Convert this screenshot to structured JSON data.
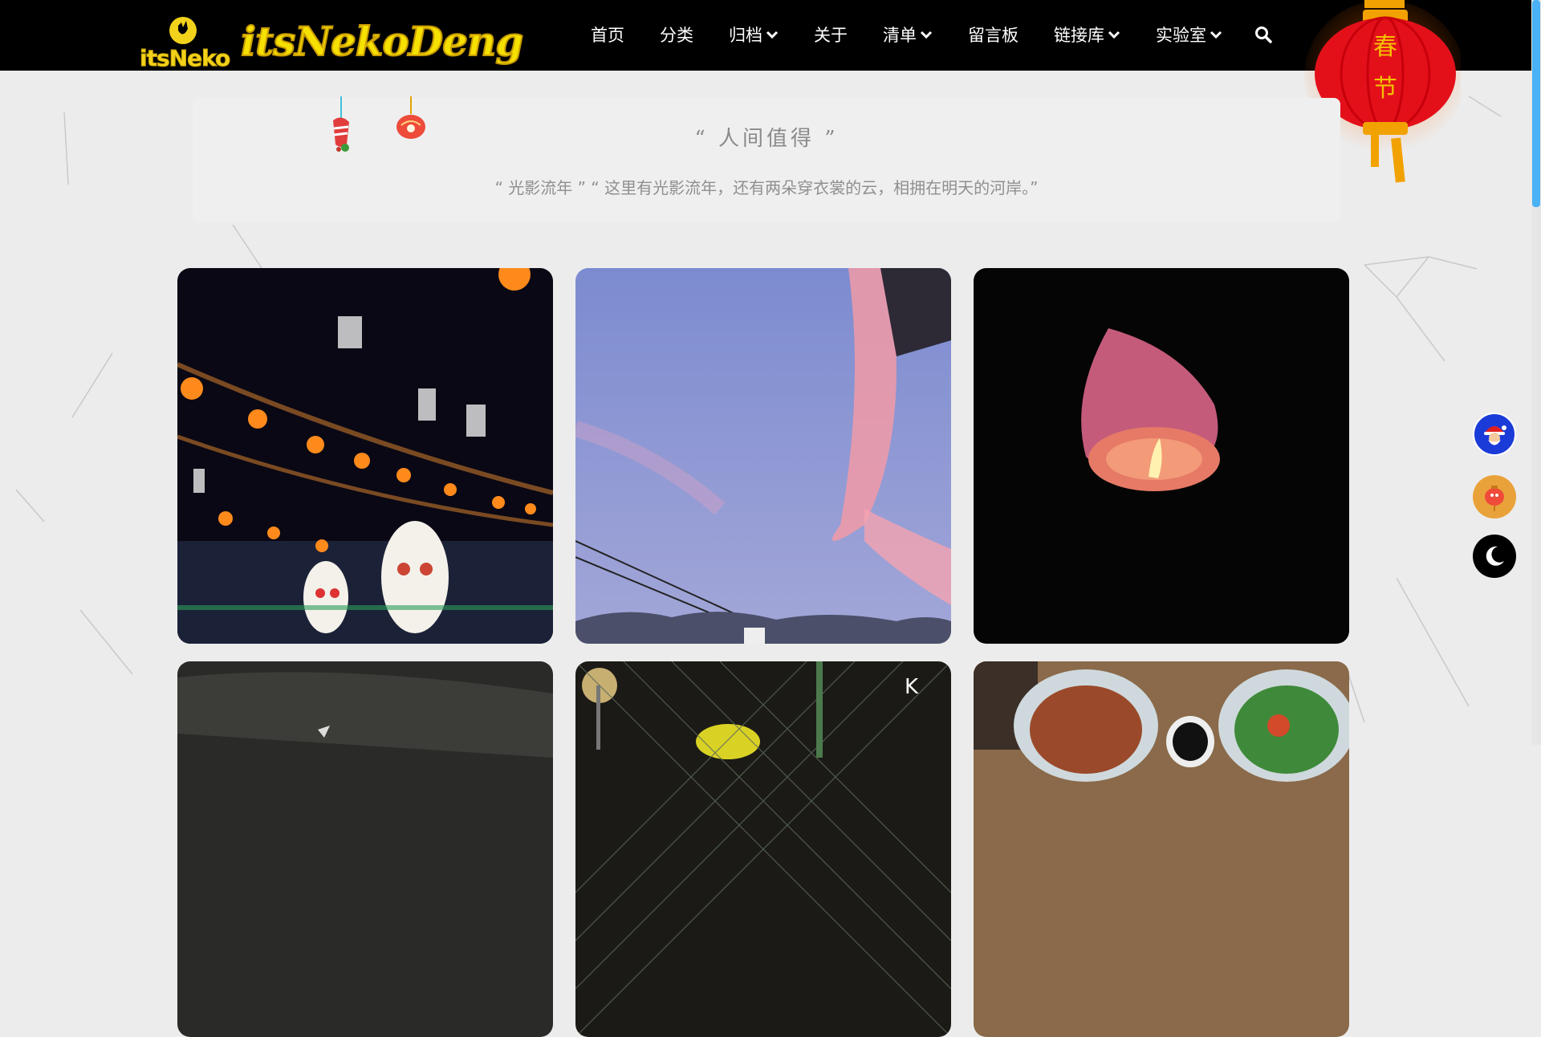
{
  "site": {
    "logo_text": "itsNeko",
    "brand_word": "itsNekoDeng"
  },
  "nav": {
    "items": [
      {
        "label": "首页",
        "dropdown": false
      },
      {
        "label": "分类",
        "dropdown": false
      },
      {
        "label": "归档",
        "dropdown": true
      },
      {
        "label": "关于",
        "dropdown": false
      },
      {
        "label": "清单",
        "dropdown": true
      },
      {
        "label": "留言板",
        "dropdown": false
      },
      {
        "label": "链接库",
        "dropdown": true
      },
      {
        "label": "实验室",
        "dropdown": true
      }
    ],
    "search_icon": "search-icon"
  },
  "lantern": {
    "text_top": "春",
    "text_bottom": "节"
  },
  "quote": {
    "title": "“ 人间值得 ”",
    "subtitle": "“ 光影流年 ” “ 这里有光影流年，还有两朵穿衣裳的云，相拥在明天的河岸。”"
  },
  "gallery": {
    "photos": [
      {
        "name": "photo-lanterns-festival"
      },
      {
        "name": "photo-pink-sky"
      },
      {
        "name": "photo-sky-lantern"
      },
      {
        "name": "photo-night-road"
      },
      {
        "name": "photo-night-fence"
      },
      {
        "name": "photo-seafood-dishes"
      }
    ]
  },
  "float_buttons": [
    {
      "name": "santa-avatar-button",
      "icon": "santa-icon"
    },
    {
      "name": "lantern-avatar-button",
      "icon": "lantern-icon"
    },
    {
      "name": "dark-mode-button",
      "icon": "moon-icon"
    }
  ],
  "colors": {
    "nav_bg": "#000000",
    "brand_yellow": "#f6e000",
    "scroll_accent": "#49b1f5",
    "page_bg": "#ececec"
  }
}
